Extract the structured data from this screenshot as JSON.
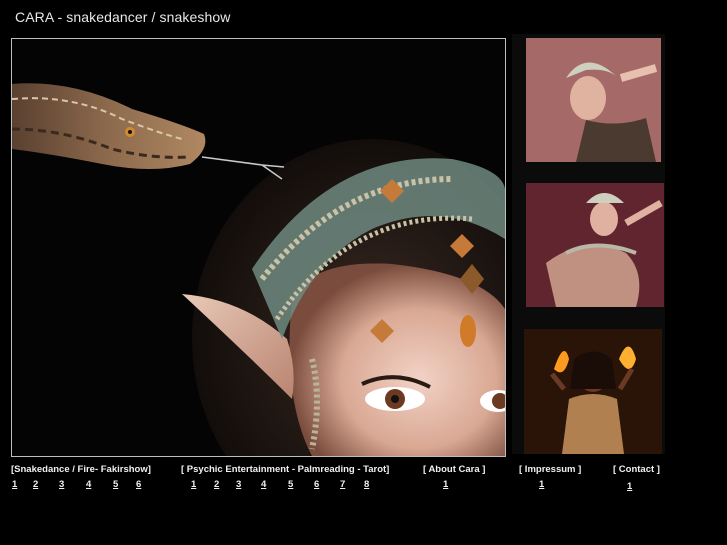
{
  "page": {
    "title": "CARA - snakedancer / snakeshow"
  },
  "nav": [
    {
      "label": "[Snakedance / Fire- Fakirshow]",
      "pages": [
        "1",
        "2",
        "3",
        "4",
        "5",
        "6"
      ]
    },
    {
      "label": "[ Psychic Entertainment - Palmreading - Tarot]",
      "pages": [
        "1",
        "2",
        "3",
        "4",
        "5",
        "6",
        "7",
        "8"
      ]
    },
    {
      "label": "[ About Cara ]",
      "pages": [
        "1"
      ]
    },
    {
      "label": "[ Impressum ]",
      "pages": [
        "1"
      ]
    },
    {
      "label": "[ Contact ]",
      "pages": [
        "1"
      ]
    }
  ],
  "colors": {
    "background": "#000000",
    "frame_border": "#bdbdbd",
    "text": "#f0f0f0"
  },
  "flags": [
    "uk-flag-icon",
    "france-flag-icon"
  ]
}
